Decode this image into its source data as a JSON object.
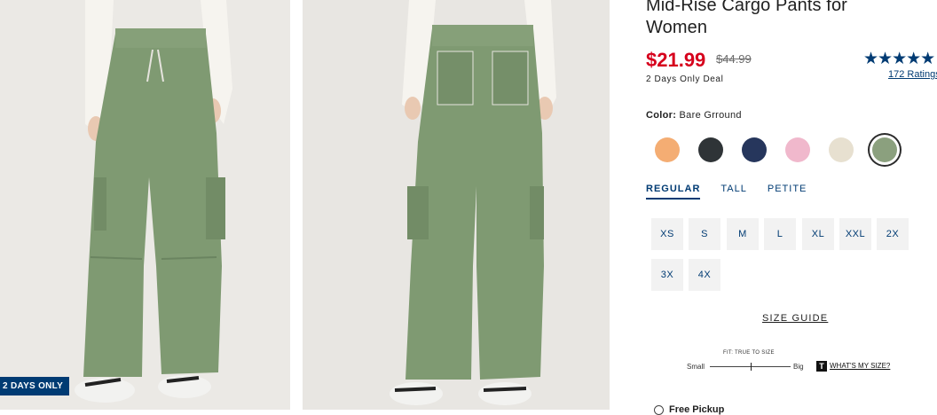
{
  "images": {
    "front_alt": "Front view of green mid-rise cargo pants",
    "back_alt": "Back view of green mid-rise cargo pants",
    "badge": "2 DAYS ONLY"
  },
  "product": {
    "title": "Mid-Rise Cargo Pants for Women",
    "price": "$21.99",
    "was_price": "$44.99",
    "deal_text": "2 Days Only Deal",
    "rating_stars": "★★★★★",
    "rating_value": 4.5,
    "rating_link": "172 Ratings"
  },
  "color": {
    "label": "Color:",
    "selected": "Bare Grround",
    "swatches": [
      {
        "name": "peach",
        "hex": "#f4ad73"
      },
      {
        "name": "black",
        "hex": "#2f3437"
      },
      {
        "name": "navy",
        "hex": "#26365c"
      },
      {
        "name": "pink",
        "hex": "#f0b8cc"
      },
      {
        "name": "cream",
        "hex": "#e7e0d0"
      },
      {
        "name": "bare-grround-green",
        "hex": "#8ba07e"
      }
    ]
  },
  "fit_tabs": [
    "REGULAR",
    "TALL",
    "PETITE"
  ],
  "sizes": [
    "XS",
    "S",
    "M",
    "L",
    "XL",
    "XXL",
    "2X",
    "3X",
    "4X"
  ],
  "size_guide": "SIZE GUIDE",
  "fit_scale": {
    "label": "FIT: TRUE TO SIZE",
    "small": "Small",
    "big": "Big",
    "value": 0.5,
    "badge": "T",
    "link": "WHAT'S MY SIZE?"
  },
  "pickup": {
    "label": "Free Pickup"
  },
  "theme": {
    "brand": "#003b73",
    "sale": "#d6001c",
    "pants": "#7f9a72"
  }
}
